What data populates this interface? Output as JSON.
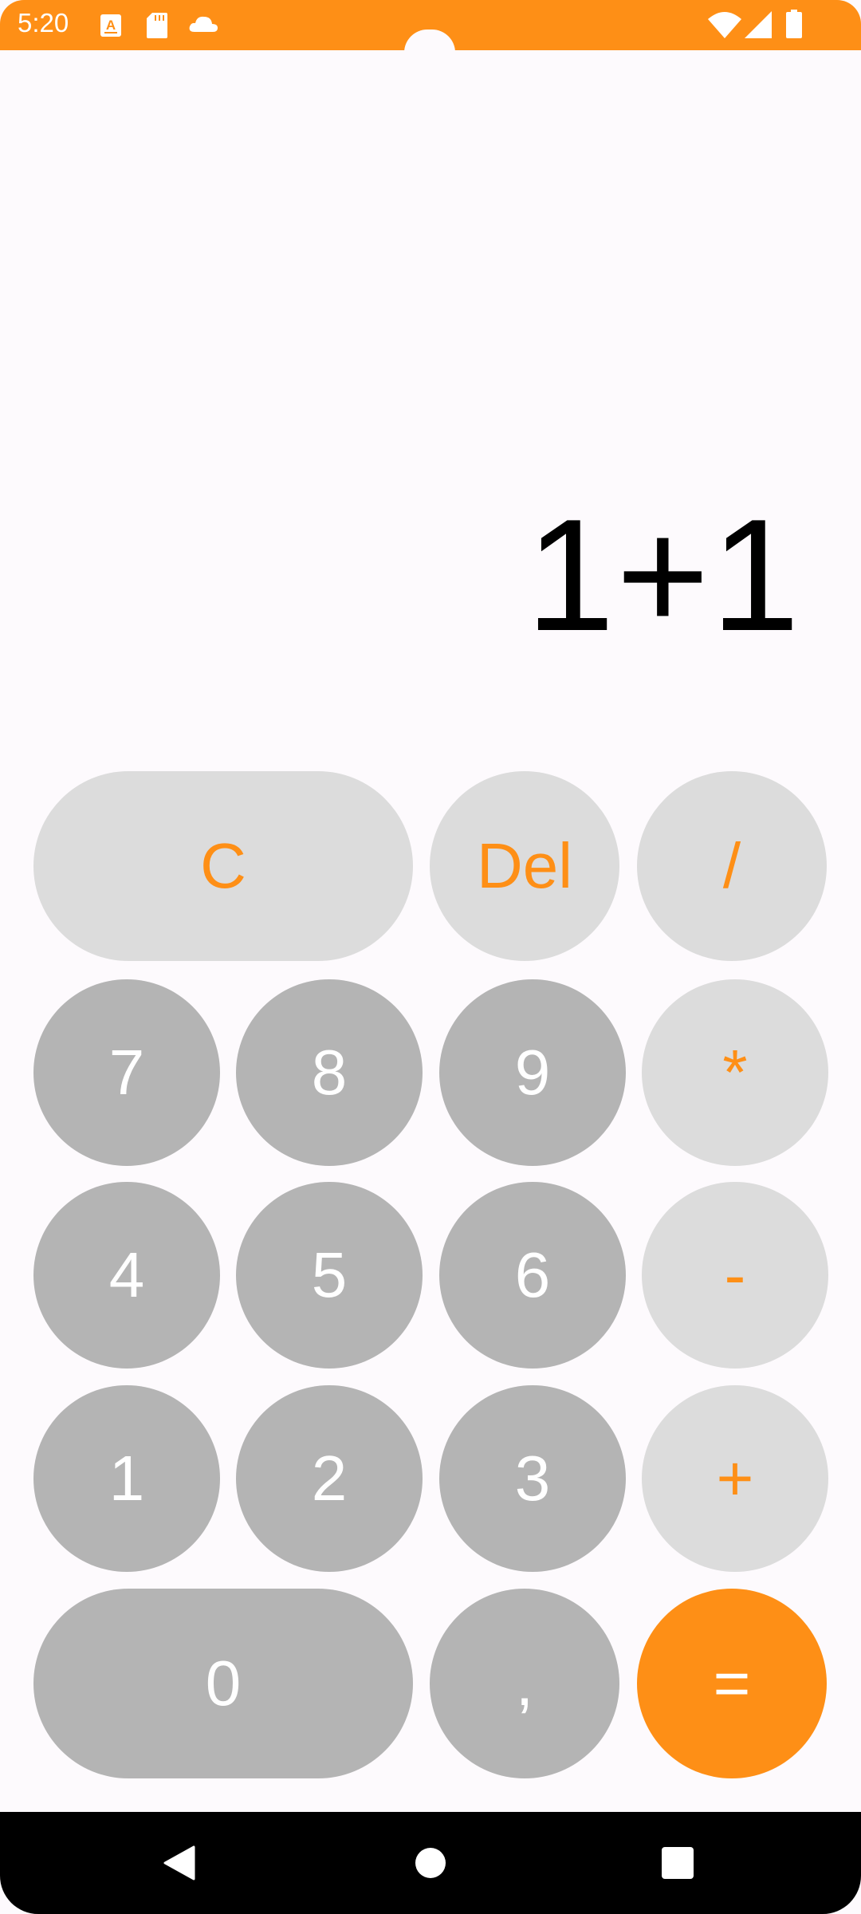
{
  "status_bar": {
    "time": "5:20",
    "left_icons": [
      "a-box-icon",
      "sd-card-icon",
      "cloud-icon"
    ],
    "right_icons": [
      "wifi-icon",
      "signal-icon",
      "battery-icon"
    ]
  },
  "display": {
    "expression": "1+1"
  },
  "keys": {
    "clear": "C",
    "delete": "Del",
    "divide": "/",
    "seven": "7",
    "eight": "8",
    "nine": "9",
    "multiply": "*",
    "four": "4",
    "five": "5",
    "six": "6",
    "subtract": "-",
    "one": "1",
    "two": "2",
    "three": "3",
    "add": "+",
    "zero": "0",
    "comma": ",",
    "equals": "="
  },
  "nav_bar": {
    "items": [
      "back-icon",
      "home-icon",
      "recents-icon"
    ]
  },
  "colors": {
    "accent": "#fe8f16",
    "function_key": "#dcdcdc",
    "number_key": "#b4b4b4",
    "background": "#fdfafd"
  }
}
